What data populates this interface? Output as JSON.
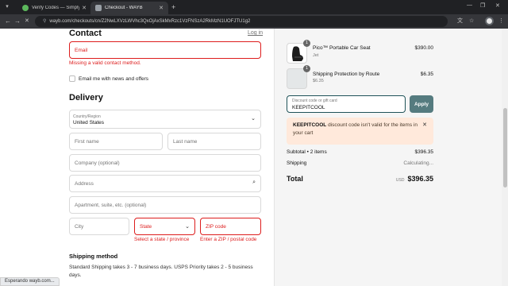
{
  "browser": {
    "tabs": [
      {
        "title": "Verify Codes — SimplyCodes"
      },
      {
        "title": "Checkout - WAYB"
      }
    ],
    "url": "wayb.com/checkouts/cn/Z2NwLXVzLWVhc3QxOjAxSkMxRzc1VzFNSzA2RkMzN1UOFJTU1g2",
    "status": "Esperando wayb.com..."
  },
  "contact": {
    "heading": "Contact",
    "login_link": "Log in",
    "email_placeholder": "Email",
    "email_error": "Missing a valid contact method.",
    "news_label": "Email me with news and offers"
  },
  "delivery": {
    "heading": "Delivery",
    "country_label": "Country/Region",
    "country_value": "United States",
    "first_name": "First name",
    "last_name": "Last name",
    "company": "Company (optional)",
    "address": "Address",
    "apartment": "Apartment, suite, etc. (optional)",
    "city": "City",
    "state": "State",
    "zip": "ZIP code",
    "state_error": "Select a state / province",
    "zip_error": "Enter a ZIP / postal code"
  },
  "shipping": {
    "heading": "Shipping method",
    "text": "Standard Shipping takes 3 - 7 business days. USPS Priority takes 2 - 5 business days."
  },
  "cart": {
    "items": [
      {
        "qty": "1",
        "name": "Pico™ Portable Car Seat",
        "variant": "Jet",
        "price": "$390.00"
      },
      {
        "qty": "1",
        "name": "Shipping Protection by Route",
        "variant": "$6.35",
        "price": "$6.35"
      }
    ],
    "discount_label": "Discount code or gift card",
    "discount_value": "KEEPITCOOL",
    "apply_label": "Apply",
    "alert_code": "KEEPITCOOL",
    "alert_text": " discount code isn't valid for the items in your cart",
    "subtotal_label": "Subtotal • 2 items",
    "subtotal_value": "$396.35",
    "shipping_label": "Shipping",
    "shipping_value": "Calculating...",
    "total_label": "Total",
    "currency": "USD",
    "total_value": "$396.35"
  },
  "colors": {
    "error": "#dd1d1d",
    "accent": "#557b7f",
    "alert_bg": "#ffe9db"
  }
}
